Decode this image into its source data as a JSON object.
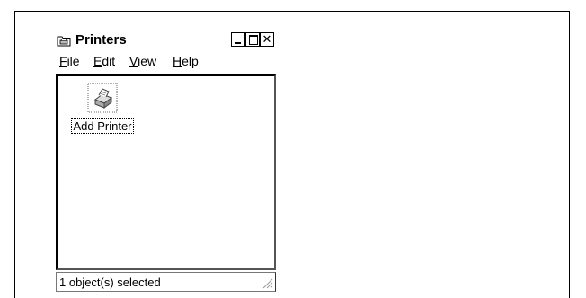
{
  "window": {
    "title": "Printers",
    "title_icon": "printers-folder-icon",
    "controls": {
      "minimize": "_",
      "maximize": "□",
      "close": "✕"
    }
  },
  "menu": {
    "items": [
      {
        "accel": "F",
        "rest": "ile"
      },
      {
        "accel": "E",
        "rest": "dit"
      },
      {
        "accel": "V",
        "rest": "iew"
      },
      {
        "accel": "H",
        "rest": "elp"
      }
    ]
  },
  "content": {
    "items": [
      {
        "label": "Add Printer",
        "icon": "add-printer-icon"
      }
    ]
  },
  "status": {
    "text": "1 object(s) selected"
  }
}
